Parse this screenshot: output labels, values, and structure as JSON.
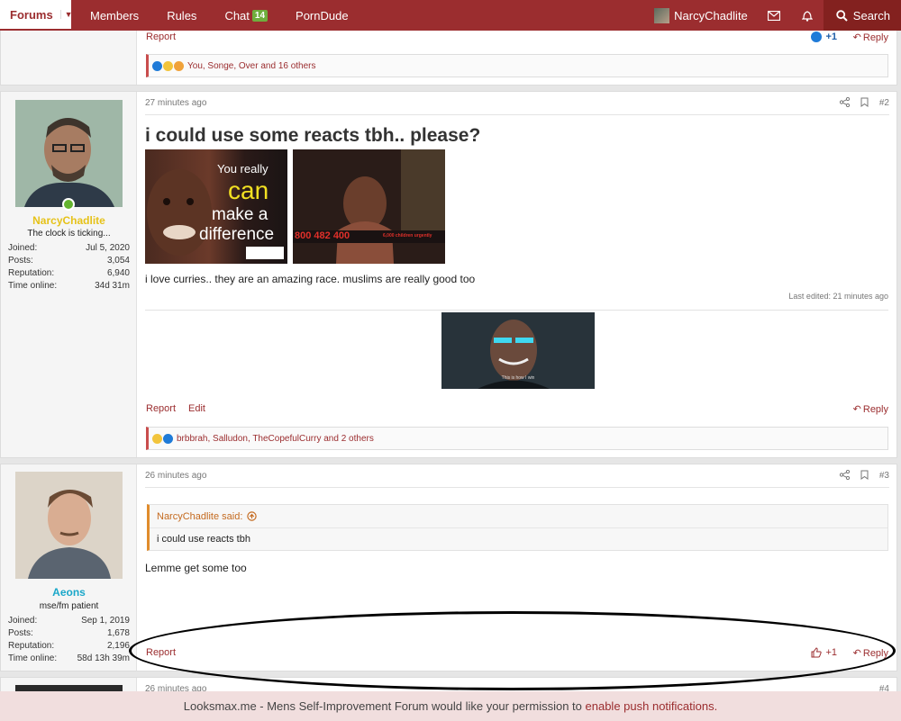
{
  "nav": {
    "forums": "Forums",
    "members": "Members",
    "rules": "Rules",
    "chat": "Chat",
    "chat_badge": "14",
    "porndude": "PornDude",
    "username": "NarcyChadlite",
    "search": "Search"
  },
  "post0": {
    "report": "Report",
    "like": "+1",
    "reply": "Reply",
    "reactions": "You, Songe, Over and 16 others"
  },
  "post2": {
    "time": "27 minutes ago",
    "num": "#2",
    "author": "NarcyChadlite",
    "user_title": "The clock is ticking...",
    "stats": [
      {
        "k": "Joined:",
        "v": "Jul 5, 2020"
      },
      {
        "k": "Posts:",
        "v": "3,054"
      },
      {
        "k": "Reputation:",
        "v": "6,940"
      },
      {
        "k": "Time online:",
        "v": "34d 31m"
      }
    ],
    "title": "i could use some reacts tbh.. please?",
    "img1_text": [
      "You really",
      "can",
      "make a",
      "difference"
    ],
    "img2_text": "800 482 400",
    "img2_small": "6,000 children urgently",
    "body": "i love curries.. they are an amazing race. muslims are really good too",
    "edited": "Last edited: 21 minutes ago",
    "img3_caption": "This is how I win",
    "report": "Report",
    "edit": "Edit",
    "reply": "Reply",
    "reactions": "brbbrah, Salludon, TheCopefulCurry and 2 others"
  },
  "post3": {
    "time": "26 minutes ago",
    "num": "#3",
    "author": "Aeons",
    "user_title": "mse/fm patient",
    "stats": [
      {
        "k": "Joined:",
        "v": "Sep 1, 2019"
      },
      {
        "k": "Posts:",
        "v": "1,678"
      },
      {
        "k": "Reputation:",
        "v": "2,196"
      },
      {
        "k": "Time online:",
        "v": "58d 13h 39m"
      }
    ],
    "quote_author": "NarcyChadlite said:",
    "quote_text": "i could use reacts tbh",
    "body": "Lemme get some too",
    "report": "Report",
    "like": "+1",
    "reply": "Reply"
  },
  "post4": {
    "time": "26 minutes ago",
    "num": "#4"
  },
  "banner": {
    "text": "Looksmax.me - Mens Self-Improvement Forum would like your permission to ",
    "link": "enable push notifications."
  },
  "colors": {
    "brand": "#9b2d2f",
    "author1": "#e6c219",
    "author2": "#1aa7c9"
  }
}
